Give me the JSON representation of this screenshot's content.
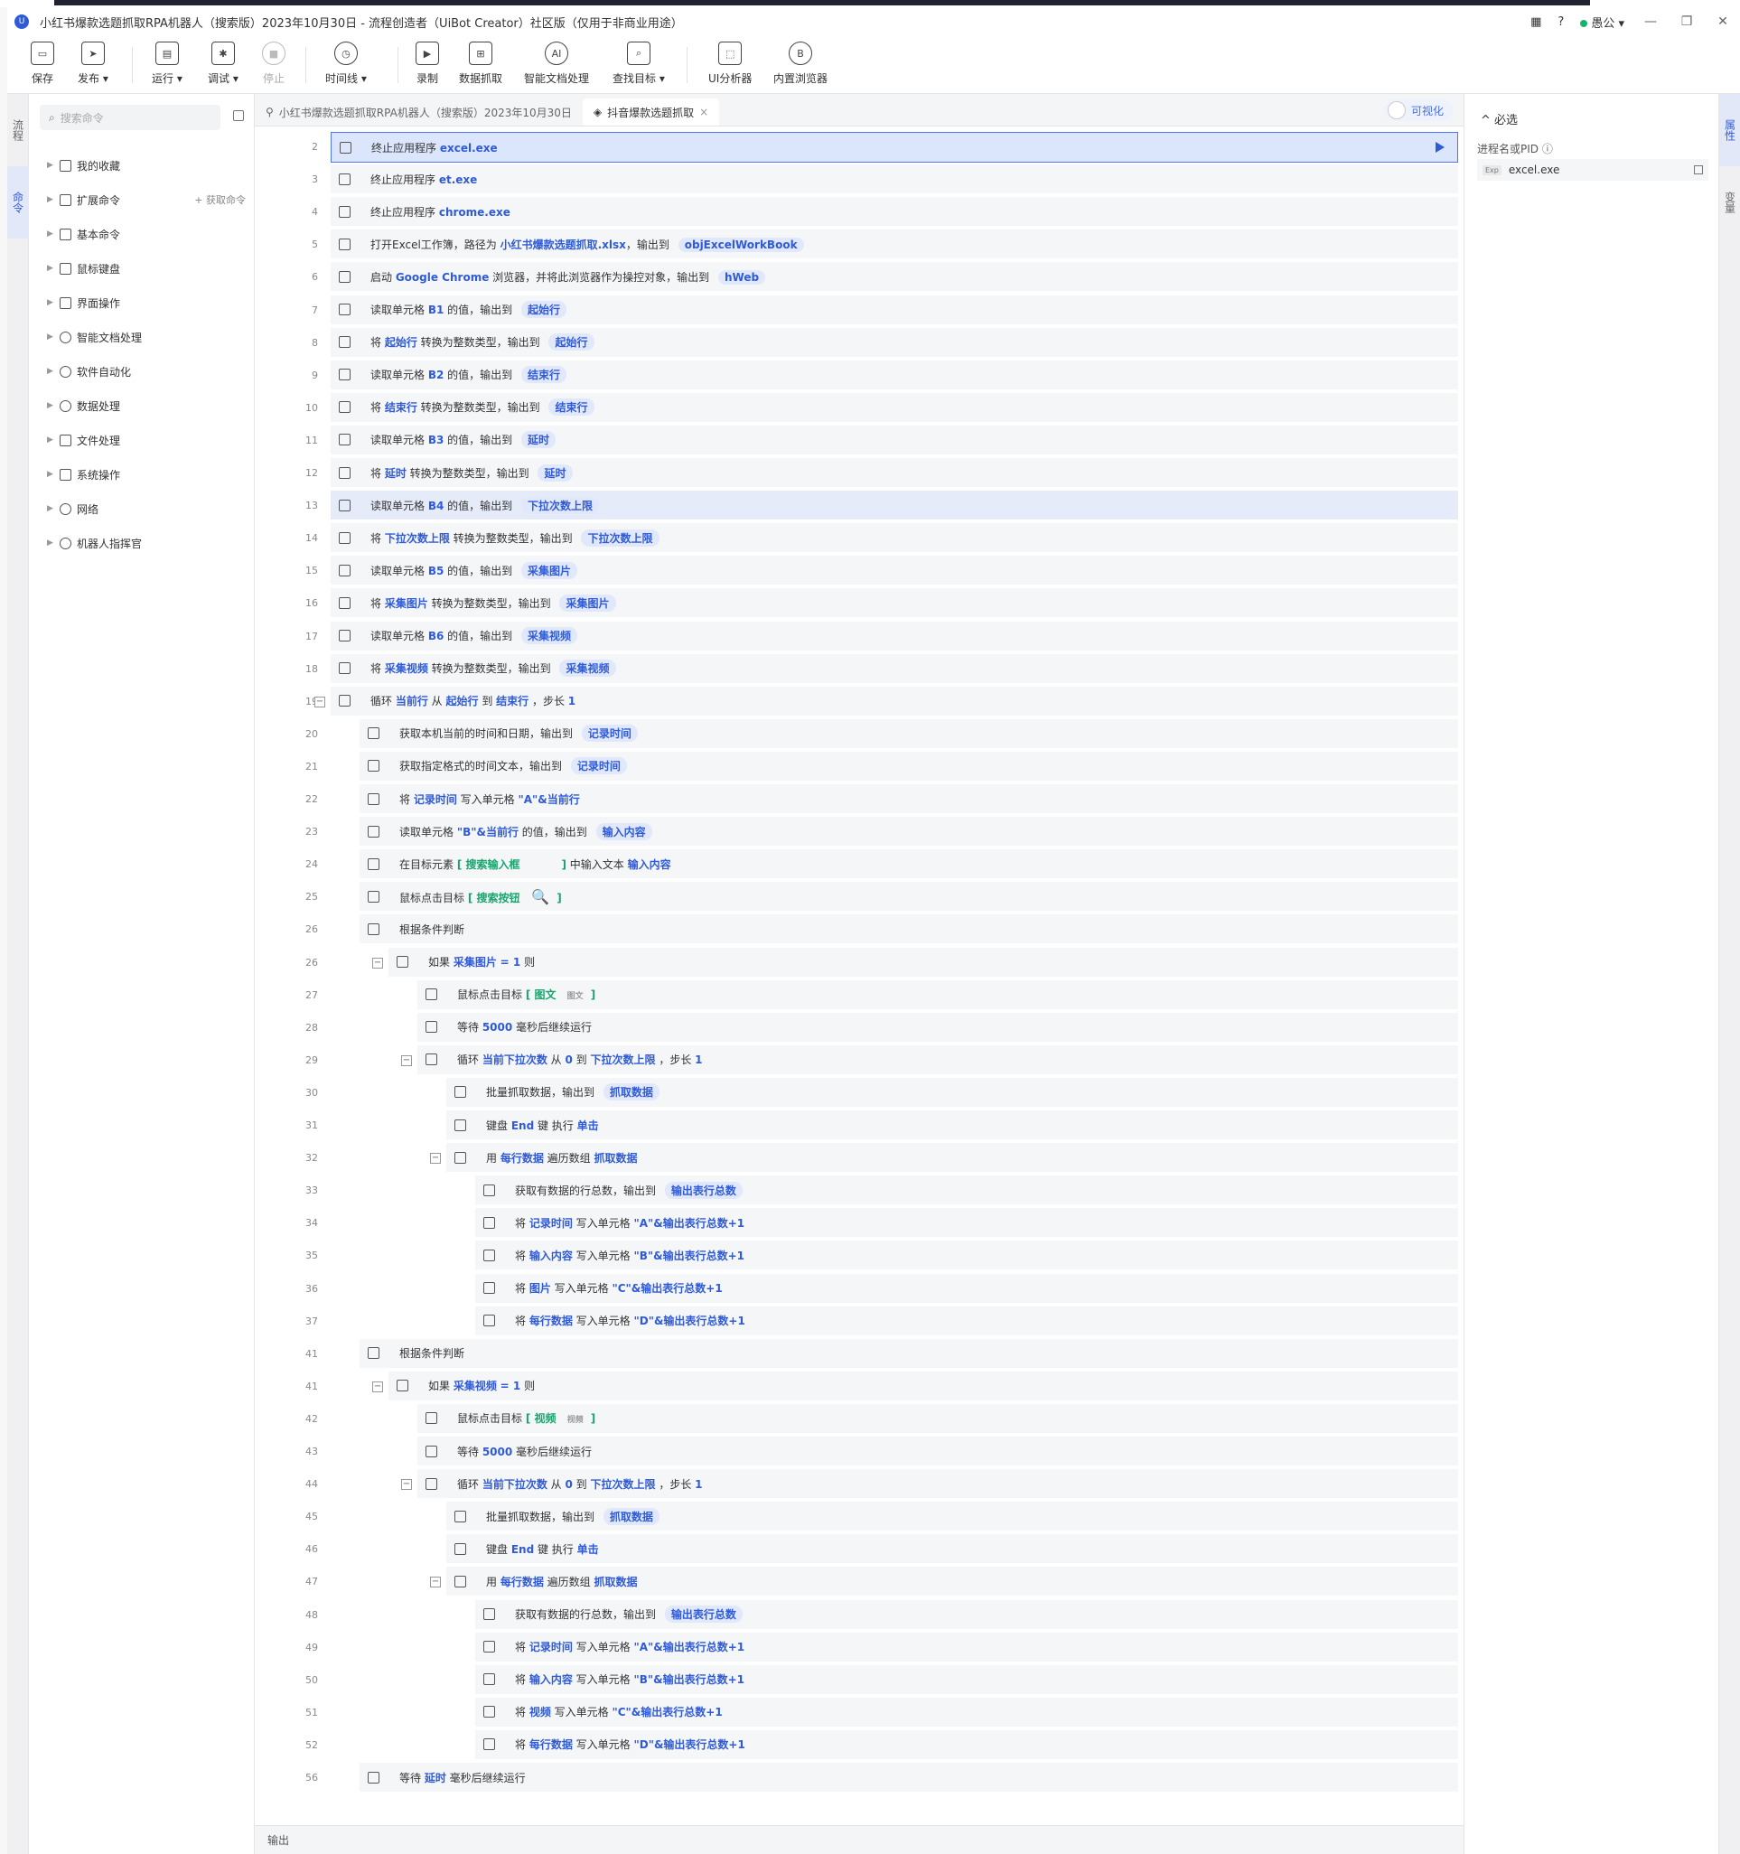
{
  "window": {
    "title": "小红书爆款选题抓取RPA机器人（搜索版）2023年10月30日 - 流程创造者（UiBot Creator）社区版（仅用于非商业用途）",
    "user": "愚公",
    "help": "?"
  },
  "toolbar": [
    {
      "label": "保存",
      "icon": "save-icon"
    },
    {
      "label": "发布 ▾",
      "icon": "publish-icon"
    },
    {
      "label": "运行 ▾",
      "icon": "run-icon"
    },
    {
      "label": "调试 ▾",
      "icon": "debug-icon"
    },
    {
      "label": "停止",
      "icon": "stop-icon"
    },
    {
      "label": "时间线 ▾",
      "icon": "timeline-icon"
    },
    {
      "label": "录制",
      "icon": "record-icon"
    },
    {
      "label": "数据抓取",
      "icon": "data-scrape-icon"
    },
    {
      "label": "智能文档处理",
      "icon": "ai-doc-icon"
    },
    {
      "label": "查找目标 ▾",
      "icon": "find-target-icon"
    },
    {
      "label": "UI分析器",
      "icon": "ui-analyzer-icon"
    },
    {
      "label": "内置浏览器",
      "icon": "browser-icon"
    }
  ],
  "left_rail": [
    "流程",
    "命令"
  ],
  "command_panel": {
    "search_placeholder": "搜索命令",
    "get_commands": "+ 获取命令",
    "items": [
      "我的收藏",
      "扩展命令",
      "基本命令",
      "鼠标键盘",
      "界面操作",
      "智能文档处理",
      "软件自动化",
      "数据处理",
      "文件处理",
      "系统操作",
      "网络",
      "机器人指挥官"
    ]
  },
  "tabs": {
    "tab1": "小红书爆款选题抓取RPA机器人（搜索版）2023年10月30日",
    "tab2": "抖音爆款选题抓取",
    "close": "×",
    "visual_toggle": "可视化"
  },
  "flow_rows": [
    {
      "n": "2",
      "indent": 0,
      "html": "终止应用程序 <b class='v'>excel.exe</b>",
      "sel": true
    },
    {
      "n": "3",
      "indent": 0,
      "html": "终止应用程序 <b class='v'>et.exe</b>"
    },
    {
      "n": "4",
      "indent": 0,
      "html": "终止应用程序 <b class='v'>chrome.exe</b>"
    },
    {
      "n": "5",
      "indent": 0,
      "html": "打开Excel工作簿，路径为 <b class='v'>小红书爆款选题抓取.xlsx</b>，输出到 <span class='p'>objExcelWorkBook</span>"
    },
    {
      "n": "6",
      "indent": 0,
      "html": "启动 <b class='v'>Google Chrome</b> 浏览器，并将此浏览器作为操控对象，输出到 <span class='p'>hWeb</span>"
    },
    {
      "n": "7",
      "indent": 0,
      "html": "读取单元格 <b class='v'>B1</b> 的值，输出到 <span class='p'>起始行</span>"
    },
    {
      "n": "8",
      "indent": 0,
      "html": "将 <b class='v'>起始行</b> 转换为整数类型，输出到 <span class='p'>起始行</span>"
    },
    {
      "n": "9",
      "indent": 0,
      "html": "读取单元格 <b class='v'>B2</b> 的值，输出到 <span class='p'>结束行</span>"
    },
    {
      "n": "10",
      "indent": 0,
      "html": "将 <b class='v'>结束行</b> 转换为整数类型，输出到 <span class='p'>结束行</span>"
    },
    {
      "n": "11",
      "indent": 0,
      "html": "读取单元格 <b class='v'>B3</b> 的值，输出到 <span class='p'>延时</span>"
    },
    {
      "n": "12",
      "indent": 0,
      "html": "将 <b class='v'>延时</b> 转换为整数类型，输出到 <span class='p'>延时</span>"
    },
    {
      "n": "13",
      "indent": 0,
      "html": "读取单元格 <b class='v'>B4</b> 的值，输出到 <span class='p'>下拉次数上限</span>",
      "hl": true
    },
    {
      "n": "14",
      "indent": 0,
      "html": "将 <b class='v'>下拉次数上限</b> 转换为整数类型，输出到 <span class='p'>下拉次数上限</span>"
    },
    {
      "n": "15",
      "indent": 0,
      "html": "读取单元格 <b class='v'>B5</b> 的值，输出到 <span class='p'>采集图片</span>"
    },
    {
      "n": "16",
      "indent": 0,
      "html": "将 <b class='v'>采集图片</b> 转换为整数类型，输出到 <span class='p'>采集图片</span>"
    },
    {
      "n": "17",
      "indent": 0,
      "html": "读取单元格 <b class='v'>B6</b> 的值，输出到 <span class='p'>采集视频</span>"
    },
    {
      "n": "18",
      "indent": 0,
      "html": "将 <b class='v'>采集视频</b> 转换为整数类型，输出到 <span class='p'>采集视频</span>"
    },
    {
      "n": "19",
      "indent": 0,
      "html": "循环 <b class='v'>当前行</b> 从 <b class='v'>起始行</b> 到 <b class='v'>结束行</b> ，步长 <b class='v'>1</b>",
      "fold": true
    },
    {
      "n": "20",
      "indent": 1,
      "html": "获取本机当前的时间和日期，输出到 <span class='p'>记录时间</span>"
    },
    {
      "n": "21",
      "indent": 1,
      "html": "获取指定格式的时间文本，输出到 <span class='p'>记录时间</span>"
    },
    {
      "n": "22",
      "indent": 1,
      "html": "将 <b class='v'>记录时间</b> 写入单元格 <b class='v'>\"A\"&amp;当前行</b>"
    },
    {
      "n": "23",
      "indent": 1,
      "html": "读取单元格 <b class='v'>\"B\"&amp;当前行</b> 的值，输出到 <span class='p'>输入内容</span>"
    },
    {
      "n": "24",
      "indent": 1,
      "html": "在目标元素 <b class='g'>[ 搜索输入框 &nbsp;&nbsp;&nbsp;&nbsp;&nbsp;&nbsp;&nbsp;&nbsp;&nbsp;&nbsp;]</b> 中输入文本 <b class='v'>输入内容</b>"
    },
    {
      "n": "25",
      "indent": 1,
      "html": "鼠标点击目标 <b class='g'>[ 搜索按钮 &nbsp;&nbsp;<span style='color:#333;font-size:16px'>🔍</span>&nbsp; ]</b>"
    },
    {
      "n": "26",
      "indent": 1,
      "html": "根据条件判断"
    },
    {
      "n": "26",
      "indent": 2,
      "html": "如果 <b class='v'>采集图片</b> <b class='v'>= 1</b> 则",
      "fold": true
    },
    {
      "n": "27",
      "indent": 3,
      "html": "鼠标点击目标 <b class='g'>[ 图文 <span class='gs'>图文</span>]</b>"
    },
    {
      "n": "28",
      "indent": 3,
      "html": "等待 <b class='v'>5000</b> 毫秒后继续运行"
    },
    {
      "n": "29",
      "indent": 3,
      "html": "循环 <b class='v'>当前下拉次数</b> 从 <b class='v'>0</b> 到 <b class='v'>下拉次数上限</b> ，步长 <b class='v'>1</b>",
      "fold": true
    },
    {
      "n": "30",
      "indent": 4,
      "html": "批量抓取数据，输出到 <span class='p'>抓取数据</span>"
    },
    {
      "n": "31",
      "indent": 4,
      "html": "键盘 <b class='v'>End</b> 键 执行 <b class='v'>单击</b>"
    },
    {
      "n": "32",
      "indent": 4,
      "html": "用 <b class='v'>每行数据</b> 遍历数组 <b class='v'>抓取数据</b>",
      "fold": true
    },
    {
      "n": "33",
      "indent": 5,
      "html": "获取有数据的行总数，输出到 <span class='p'>输出表行总数</span>"
    },
    {
      "n": "34",
      "indent": 5,
      "html": "将 <b class='v'>记录时间</b> 写入单元格 <b class='v'>\"A\"&amp;输出表行总数+1</b>"
    },
    {
      "n": "35",
      "indent": 5,
      "html": "将 <b class='v'>输入内容</b> 写入单元格 <b class='v'>\"B\"&amp;输出表行总数+1</b>"
    },
    {
      "n": "36",
      "indent": 5,
      "html": "将 <b class='v'>图片</b> 写入单元格 <b class='v'>\"C\"&amp;输出表行总数+1</b>"
    },
    {
      "n": "37",
      "indent": 5,
      "html": "将 <b class='v'>每行数据</b> 写入单元格 <b class='v'>\"D\"&amp;输出表行总数+1</b>"
    },
    {
      "n": "41",
      "indent": 1,
      "html": "根据条件判断"
    },
    {
      "n": "41",
      "indent": 2,
      "html": "如果 <b class='v'>采集视频</b> <b class='v'>= 1</b> 则",
      "fold": true
    },
    {
      "n": "42",
      "indent": 3,
      "html": "鼠标点击目标 <b class='g'>[ 视频 <span class='gs'>视频</span>]</b>"
    },
    {
      "n": "43",
      "indent": 3,
      "html": "等待 <b class='v'>5000</b> 毫秒后继续运行"
    },
    {
      "n": "44",
      "indent": 3,
      "html": "循环 <b class='v'>当前下拉次数</b> 从 <b class='v'>0</b> 到 <b class='v'>下拉次数上限</b> ，步长 <b class='v'>1</b>",
      "fold": true
    },
    {
      "n": "45",
      "indent": 4,
      "html": "批量抓取数据，输出到 <span class='p'>抓取数据</span>"
    },
    {
      "n": "46",
      "indent": 4,
      "html": "键盘 <b class='v'>End</b> 键 执行 <b class='v'>单击</b>"
    },
    {
      "n": "47",
      "indent": 4,
      "html": "用 <b class='v'>每行数据</b> 遍历数组 <b class='v'>抓取数据</b>",
      "fold": true
    },
    {
      "n": "48",
      "indent": 5,
      "html": "获取有数据的行总数，输出到 <span class='p'>输出表行总数</span>"
    },
    {
      "n": "49",
      "indent": 5,
      "html": "将 <b class='v'>记录时间</b> 写入单元格 <b class='v'>\"A\"&amp;输出表行总数+1</b>"
    },
    {
      "n": "50",
      "indent": 5,
      "html": "将 <b class='v'>输入内容</b> 写入单元格 <b class='v'>\"B\"&amp;输出表行总数+1</b>"
    },
    {
      "n": "51",
      "indent": 5,
      "html": "将 <b class='v'>视频</b> 写入单元格 <b class='v'>\"C\"&amp;输出表行总数+1</b>"
    },
    {
      "n": "52",
      "indent": 5,
      "html": "将 <b class='v'>每行数据</b> 写入单元格 <b class='v'>\"D\"&amp;输出表行总数+1</b>"
    },
    {
      "n": "56",
      "indent": 1,
      "html": "等待 <b class='v'>延时</b> 毫秒后继续运行"
    }
  ],
  "right_panel": {
    "section": "^ 必选",
    "field_label": "进程名或PID ⓘ",
    "exp_badge": "Exp",
    "field_value": "excel.exe"
  },
  "right_rail": [
    "属性",
    "变量"
  ],
  "output_label": "输出"
}
